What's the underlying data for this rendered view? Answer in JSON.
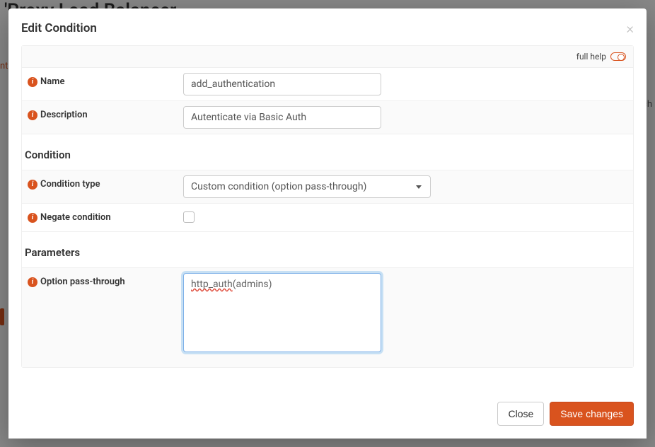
{
  "background": {
    "page_title_fragment": "'Proxy Load Balancer",
    "tab_fragment": "nt",
    "search_fragment": "ch"
  },
  "modal": {
    "title": "Edit Condition",
    "full_help_label": "full help",
    "fields": {
      "name": {
        "label": "Name",
        "value": "add_authentication"
      },
      "description": {
        "label": "Description",
        "value": "Autenticate via Basic Auth"
      }
    },
    "condition": {
      "section_title": "Condition",
      "type_label": "Condition type",
      "type_value": "Custom condition (option pass-through)",
      "negate_label": "Negate condition",
      "negate_checked": false
    },
    "parameters": {
      "section_title": "Parameters",
      "passthrough_label": "Option pass-through",
      "passthrough_value_pre": "http_auth",
      "passthrough_value_post": "(admins)"
    },
    "buttons": {
      "close": "Close",
      "save": "Save changes"
    }
  }
}
